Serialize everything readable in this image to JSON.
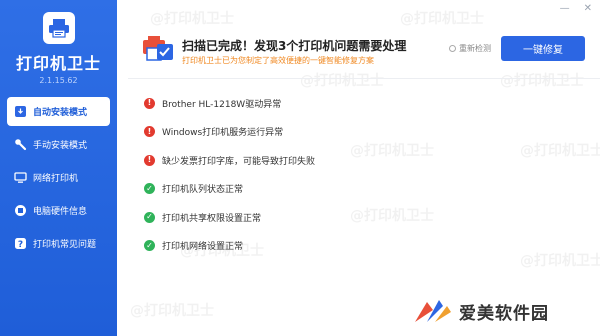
{
  "sidebar": {
    "app_title": "打印机卫士",
    "version": "2.1.15.62",
    "items": [
      {
        "label": "自动安装模式",
        "icon": "download-box-icon",
        "active": true
      },
      {
        "label": "手动安装模式",
        "icon": "wrench-icon",
        "active": false
      },
      {
        "label": "网络打印机",
        "icon": "monitor-icon",
        "active": false
      },
      {
        "label": "电脑硬件信息",
        "icon": "hardware-chip-icon",
        "active": false
      },
      {
        "label": "打印机常见问题",
        "icon": "help-icon",
        "active": false
      }
    ]
  },
  "window": {
    "minimize": "—",
    "close": "✕"
  },
  "header": {
    "title": "扫描已完成！发现3个打印机问题需要处理",
    "subtitle": "打印机卫士已为您制定了高效便捷的一键智能修复方案",
    "rescan_label": "重新检测",
    "fix_button": "一键修复",
    "icon": "printer-scan-icon"
  },
  "issues": [
    {
      "status": "error",
      "text": "Brother  HL-1218W驱动异常"
    },
    {
      "status": "error",
      "text": "Windows打印机服务运行异常"
    },
    {
      "status": "error",
      "text": "缺少发票打印字库，可能导致打印失败"
    },
    {
      "status": "ok",
      "text": "打印机队列状态正常"
    },
    {
      "status": "ok",
      "text": "打印机共享权限设置正常"
    },
    {
      "status": "ok",
      "text": "打印机网络设置正常"
    }
  ],
  "watermark_text": "@打印机卫士",
  "brand": {
    "text": "爱美软件园"
  },
  "colors": {
    "sidebar": "#2160da",
    "accent": "#2c66e3",
    "error": "#e23a2f",
    "ok": "#2fb35a",
    "subtitle": "#f08a24"
  }
}
